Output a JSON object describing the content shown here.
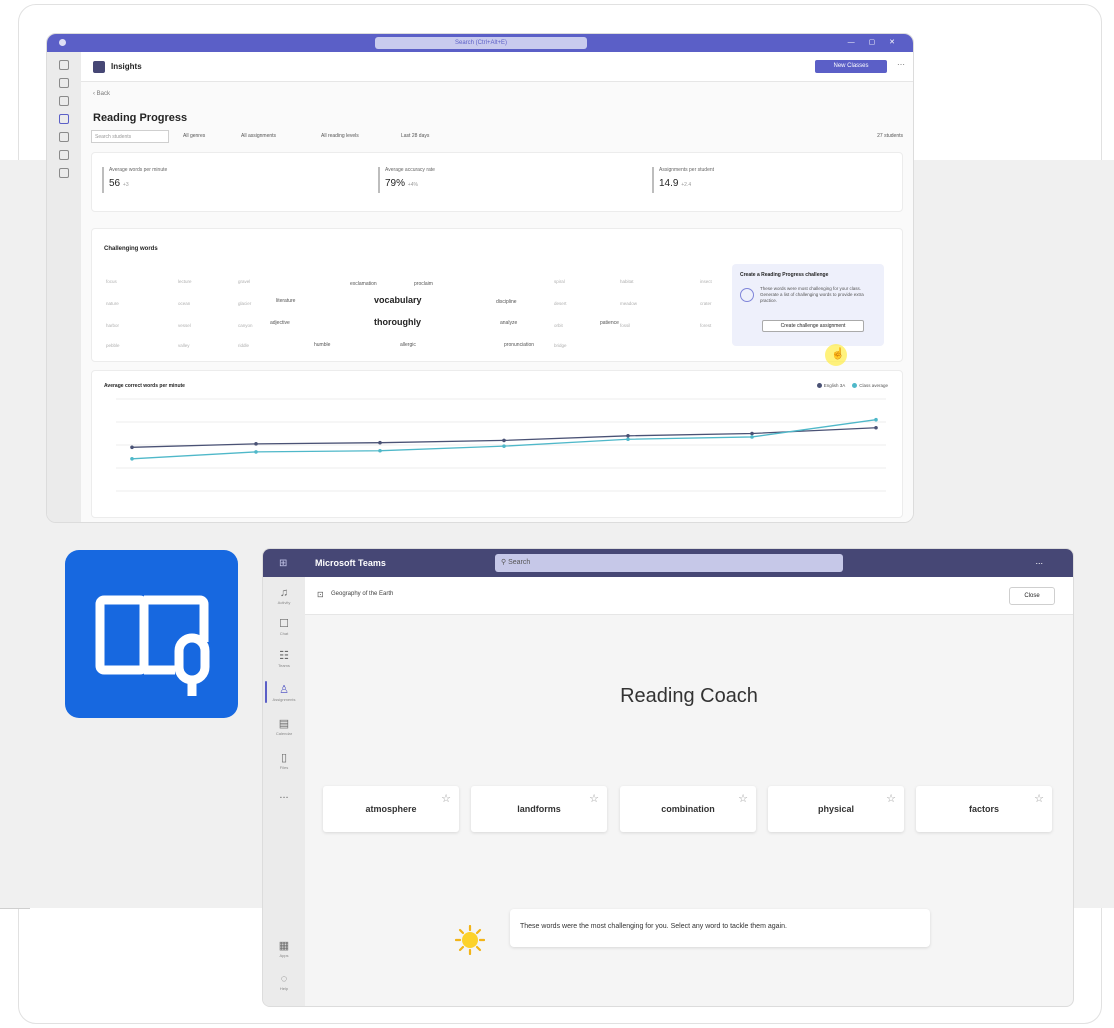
{
  "insights": {
    "search_placeholder": "Search (Ctrl+Alt+E)",
    "app_name": "Insights",
    "new_button": "New Classes",
    "back_label": "Back",
    "page_title": "Reading Progress",
    "filter_search": "Search students",
    "filters": [
      "All genres",
      "All assignments",
      "All reading levels",
      "Last 28 days"
    ],
    "student_count": "27 students",
    "stats": [
      {
        "label": "Average words per minute",
        "value": "56",
        "delta": "+3"
      },
      {
        "label": "Average accuracy rate",
        "value": "79%",
        "delta": "+4%"
      },
      {
        "label": "Assignments per student",
        "value": "14.9",
        "delta": "+2.4"
      }
    ],
    "challenging_title": "Challenging words",
    "words": {
      "bold": [
        "vocabulary",
        "thoroughly"
      ],
      "medium": [
        "literature",
        "adjective",
        "exclamation",
        "discipline",
        "analyze",
        "patience",
        "proclaim",
        "allergic",
        "pronunciation",
        "humble"
      ],
      "faint": [
        "focus",
        "lecture",
        "gravel",
        "spiral",
        "habitat",
        "insect",
        "nature",
        "ocean",
        "glacier",
        "desert",
        "meadow",
        "crater",
        "harbor",
        "vessel",
        "canyon",
        "orbit",
        "fossil",
        "forest",
        "pebble",
        "valley",
        "riddle",
        "bridge"
      ]
    },
    "challenge_panel": {
      "title": "Create a Reading Progress challenge",
      "description": "These words were most challenging for your class. Generate a list of challenging words to provide extra practice.",
      "button": "Create challenge assignment"
    },
    "chart_title": "Average correct words per minute",
    "legend": [
      "English 3A",
      "Class average"
    ]
  },
  "chart_data": {
    "type": "line",
    "x": [
      "",
      "",
      "",
      "",
      "",
      "",
      ""
    ],
    "series": [
      {
        "name": "English 3A",
        "values": [
          38,
          41,
          42,
          44,
          48,
          50,
          55
        ]
      },
      {
        "name": "Class average",
        "values": [
          28,
          34,
          35,
          39,
          45,
          47,
          62
        ]
      }
    ],
    "title": "Average correct words per minute",
    "ylim": [
      0,
      80
    ],
    "grid": true,
    "legend": "top-right"
  },
  "teams": {
    "app_name": "Microsoft Teams",
    "search_placeholder": "Search",
    "more": "...",
    "rail": [
      {
        "label": "Activity",
        "icon": "bell-icon"
      },
      {
        "label": "Chat",
        "icon": "chat-icon"
      },
      {
        "label": "Teams",
        "icon": "teams-icon"
      },
      {
        "label": "Assignments",
        "icon": "assignment-icon"
      },
      {
        "label": "Calendar",
        "icon": "calendar-icon"
      },
      {
        "label": "Files",
        "icon": "files-icon"
      },
      {
        "label": "...",
        "icon": "more-icon"
      }
    ],
    "rail_bottom": [
      {
        "label": "Apps",
        "icon": "apps-icon"
      },
      {
        "label": "Help",
        "icon": "help-icon"
      }
    ],
    "header_title": "Geography of the Earth",
    "close_button": "Close",
    "main_title": "Reading Coach",
    "word_cards": [
      "atmosphere",
      "landforms",
      "combination",
      "physical",
      "factors"
    ],
    "coach_message": "These words were the most challenging for you. Select any word to tackle them again."
  }
}
